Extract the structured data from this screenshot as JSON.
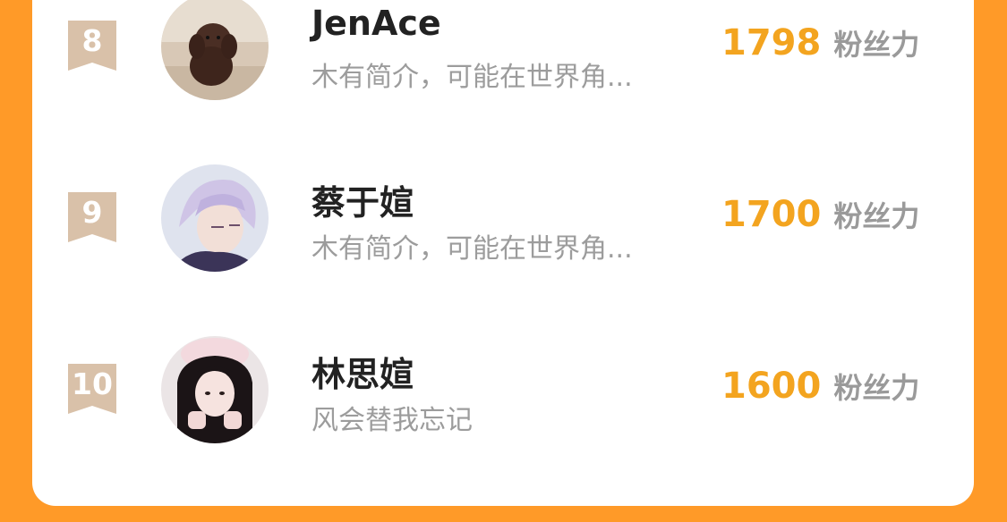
{
  "leaderboard": {
    "rows": [
      {
        "rank": "8",
        "name": "JenAce",
        "bio": "木有简介，可能在世界角...",
        "score": "1798",
        "unit": "粉丝力",
        "avatar": "avatar-dog"
      },
      {
        "rank": "9",
        "name": "蔡于媗",
        "bio": "木有简介，可能在世界角...",
        "score": "1700",
        "unit": "粉丝力",
        "avatar": "avatar-anime-boy"
      },
      {
        "rank": "10",
        "name": "林思媗",
        "bio": "风会替我忘记",
        "score": "1600",
        "unit": "粉丝力",
        "avatar": "avatar-girl"
      }
    ]
  },
  "colors": {
    "background": "#ff9a28",
    "card": "#ffffff",
    "badge": "#d9c1a9",
    "score": "#f3a41f",
    "unit": "#9a9a9a",
    "name": "#222222",
    "bio": "#9c9c9c"
  }
}
